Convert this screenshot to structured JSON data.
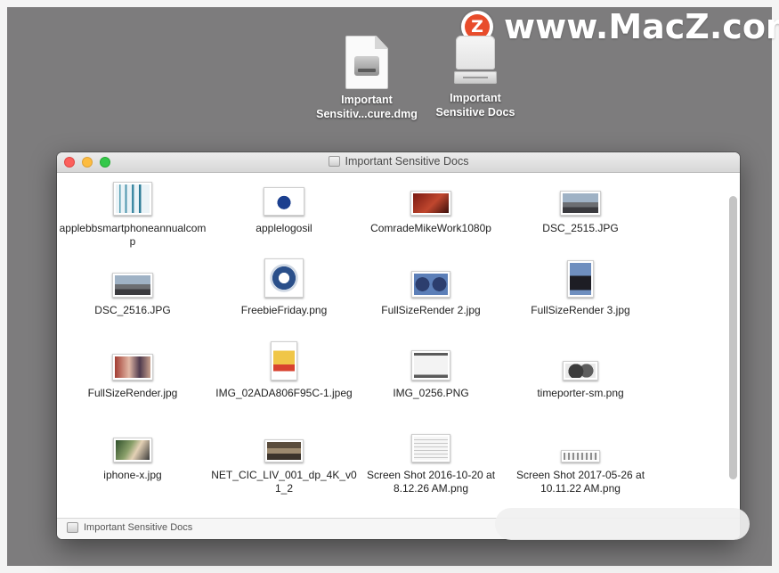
{
  "watermark": {
    "logo_letter": "Z",
    "text": "www.MacZ.com"
  },
  "desktop": {
    "icons": [
      {
        "label_line1": "Important",
        "label_line2": "Sensitiv...cure.dmg",
        "icon": "dmg-file-icon"
      },
      {
        "label_line1": "Important",
        "label_line2": "Sensitive Docs",
        "icon": "mounted-volume-icon"
      }
    ]
  },
  "window": {
    "title": "Important Sensitive Docs",
    "status_path": "Important Sensitive Docs",
    "files": [
      {
        "name": "applebbsmartphoneannualcomp",
        "thumb": "chart"
      },
      {
        "name": "applelogosil",
        "thumb": "apple"
      },
      {
        "name": "ComradeMikeWork1080p",
        "thumb": "red"
      },
      {
        "name": "DSC_2515.JPG",
        "thumb": "photo"
      },
      {
        "name": "DSC_2516.JPG",
        "thumb": "photo"
      },
      {
        "name": "FreebieFriday.png",
        "thumb": "badge"
      },
      {
        "name": "FullSizeRender 2.jpg",
        "thumb": "blue"
      },
      {
        "name": "FullSizeRender 3.jpg",
        "thumb": "portrait"
      },
      {
        "name": "FullSizeRender.jpg",
        "thumb": "group"
      },
      {
        "name": "IMG_02ADA806F95C-1.jpeg",
        "thumb": "poster"
      },
      {
        "name": "IMG_0256.PNG",
        "thumb": "screen"
      },
      {
        "name": "timeporter-sm.png",
        "thumb": "device"
      },
      {
        "name": "iphone-x.jpg",
        "thumb": "phone"
      },
      {
        "name": "NET_CIC_LIV_001_dp_4K_v01_2",
        "thumb": "room"
      },
      {
        "name": "Screen Shot 2016-10-20 at 8.12.26 AM.png",
        "thumb": "doc"
      },
      {
        "name": "Screen Shot 2017-05-26 at 10.11.22 AM.png",
        "thumb": "bar"
      }
    ]
  }
}
